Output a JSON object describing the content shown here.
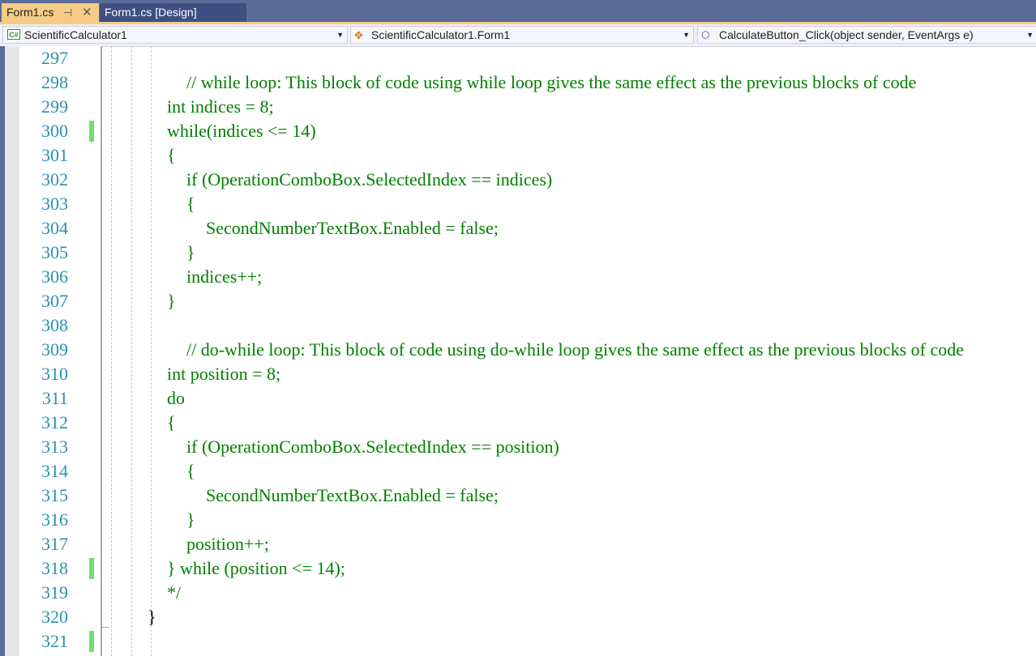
{
  "tabs": [
    {
      "label": "Form1.cs",
      "active": true,
      "pin_icon": "pin-icon",
      "close_icon": "close-icon"
    },
    {
      "label": "Form1.cs [Design]",
      "active": false
    }
  ],
  "navbar": {
    "project": {
      "icon": "csharp-project-icon",
      "label": "ScientificCalculator1"
    },
    "type": {
      "icon": "class-icon",
      "label": "ScientificCalculator1.Form1"
    },
    "member": {
      "icon": "method-icon",
      "label": "CalculateButton_Click(object sender, EventArgs e)"
    }
  },
  "colors": {
    "comment": "#008000",
    "line_number": "#2b91af",
    "change_marker": "#6ee06e",
    "tab_active_bg": "#f5cc84",
    "tab_inactive_bg": "#3e4f82",
    "frame_bg": "#5d6b99"
  },
  "editor": {
    "lines": [
      {
        "num": "297",
        "text": "",
        "changed": false
      },
      {
        "num": "298",
        "text": "// while loop: This block of code using while loop gives the same effect as the previous blocks of code",
        "indent": 1,
        "changed": false
      },
      {
        "num": "299",
        "text": "int indices = 8;",
        "indent": 0,
        "changed": false
      },
      {
        "num": "300",
        "text": "while(indices <= 14)",
        "indent": 0,
        "changed": true
      },
      {
        "num": "301",
        "text": "{",
        "indent": 0,
        "changed": false
      },
      {
        "num": "302",
        "text": "if (OperationComboBox.SelectedIndex == indices)",
        "indent": 1,
        "changed": false
      },
      {
        "num": "303",
        "text": "{",
        "indent": 1,
        "changed": false
      },
      {
        "num": "304",
        "text": "SecondNumberTextBox.Enabled = false;",
        "indent": 2,
        "changed": false
      },
      {
        "num": "305",
        "text": "}",
        "indent": 1,
        "changed": false
      },
      {
        "num": "306",
        "text": "indices++;",
        "indent": 1,
        "changed": false
      },
      {
        "num": "307",
        "text": "}",
        "indent": 0,
        "changed": false
      },
      {
        "num": "308",
        "text": "",
        "changed": false
      },
      {
        "num": "309",
        "text": "// do-while loop: This block of code using do-while loop gives the same effect as the previous blocks of code",
        "indent": 1,
        "changed": false
      },
      {
        "num": "310",
        "text": "int position = 8;",
        "indent": 0,
        "changed": false
      },
      {
        "num": "311",
        "text": "do",
        "indent": 0,
        "changed": false
      },
      {
        "num": "312",
        "text": "{",
        "indent": 0,
        "changed": false
      },
      {
        "num": "313",
        "text": "if (OperationComboBox.SelectedIndex == position)",
        "indent": 1,
        "changed": false
      },
      {
        "num": "314",
        "text": "{",
        "indent": 1,
        "changed": false
      },
      {
        "num": "315",
        "text": "SecondNumberTextBox.Enabled = false;",
        "indent": 2,
        "changed": false
      },
      {
        "num": "316",
        "text": "}",
        "indent": 1,
        "changed": false
      },
      {
        "num": "317",
        "text": "position++;",
        "indent": 1,
        "changed": false
      },
      {
        "num": "318",
        "text": "} while (position <= 14);",
        "indent": 0,
        "changed": true
      },
      {
        "num": "319",
        "text": "*/",
        "indent": 0,
        "changed": false
      },
      {
        "num": "320",
        "text": "}",
        "indent": -1,
        "changed": false,
        "plain": true
      },
      {
        "num": "321",
        "text": "",
        "changed": true
      }
    ]
  }
}
